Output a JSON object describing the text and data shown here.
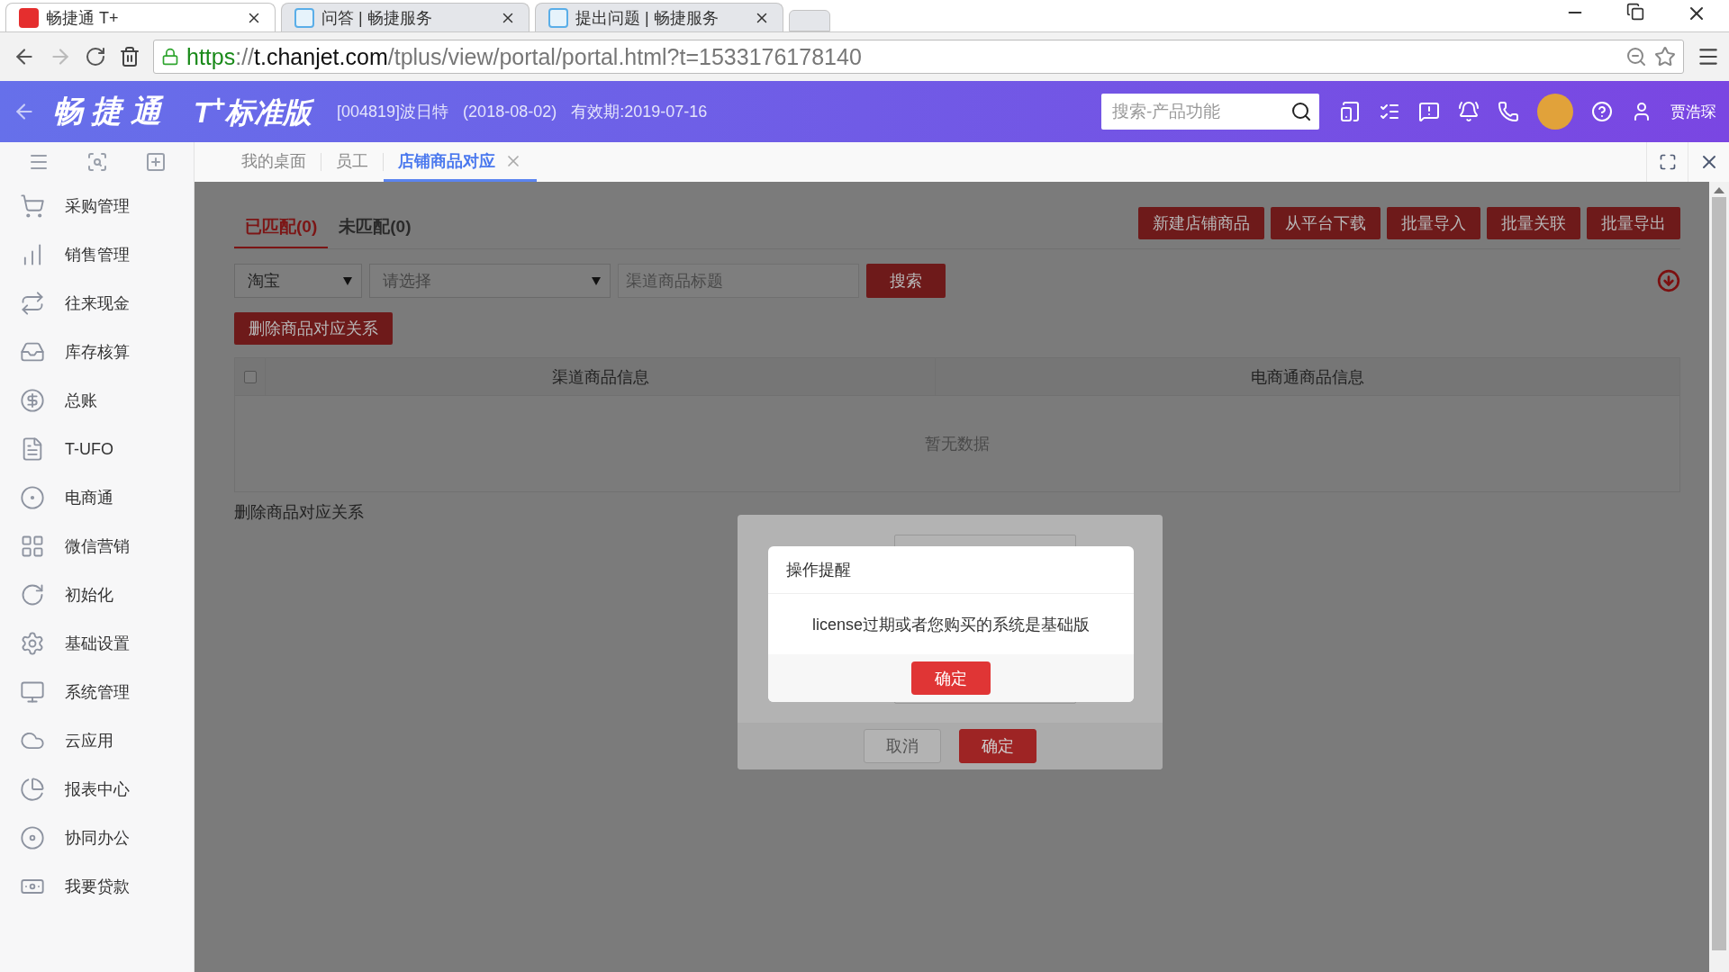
{
  "browser": {
    "tabs": [
      {
        "title": "畅捷通 T+",
        "selected": true,
        "kind": "app"
      },
      {
        "title": "问答 | 畅捷服务",
        "selected": false,
        "kind": "service"
      },
      {
        "title": "提出问题 | 畅捷服务",
        "selected": false,
        "kind": "service"
      }
    ],
    "url": {
      "scheme": "https",
      "separator": "://",
      "host": "t.chanjet.com",
      "path": "/tplus/view/portal/portal.html?t=1533176178140"
    }
  },
  "header": {
    "logo": "畅 捷 通",
    "product": "T$^{+}$标准版",
    "company": "[004819]波日特",
    "date": "(2018-08-02)",
    "expiry": "有效期:2019-07-16",
    "search": {
      "placeholder": "搜索-产品功能"
    },
    "user": "贾浩琛"
  },
  "sidebar": {
    "items": [
      {
        "label": "采购管理"
      },
      {
        "label": "销售管理"
      },
      {
        "label": "往来现金"
      },
      {
        "label": "库存核算"
      },
      {
        "label": "总账"
      },
      {
        "label": "T-UFO"
      },
      {
        "label": "电商通"
      },
      {
        "label": "微信营销"
      },
      {
        "label": "初始化"
      },
      {
        "label": "基础设置"
      },
      {
        "label": "系统管理"
      },
      {
        "label": "云应用"
      },
      {
        "label": "报表中心"
      },
      {
        "label": "协同办公"
      },
      {
        "label": "我要贷款"
      }
    ]
  },
  "page_tabs": [
    {
      "label": "我的桌面",
      "selected": false,
      "closable": false
    },
    {
      "label": "员工",
      "selected": false,
      "closable": false
    },
    {
      "label": "店铺商品对应",
      "selected": true,
      "closable": true
    }
  ],
  "sub_tabs": [
    {
      "label": "已匹配(0)",
      "selected": true
    },
    {
      "label": "未匹配(0)",
      "selected": false
    }
  ],
  "actions": [
    "新建店铺商品",
    "从平台下载",
    "批量导入",
    "批量关联",
    "批量导出"
  ],
  "filters": {
    "platform": "淘宝",
    "category": {
      "placeholder": "请选择"
    },
    "title": {
      "placeholder": "渠道商品标题"
    },
    "search_button": "搜索"
  },
  "delete_button": "删除商品对应关系",
  "table": {
    "select_all_checked": false,
    "columns": [
      "渠道商品信息",
      "电商通商品信息"
    ],
    "empty_text": "暂无数据"
  },
  "footer_text": "删除商品对应关系",
  "back_dialog": {
    "buttons": [
      {
        "label": "取消",
        "kind": "secondary"
      },
      {
        "label": "确定",
        "kind": "primary"
      }
    ]
  },
  "alert": {
    "title": "操作提醒",
    "message": "license过期或者您购买的系统是基础版",
    "button": "确定"
  }
}
